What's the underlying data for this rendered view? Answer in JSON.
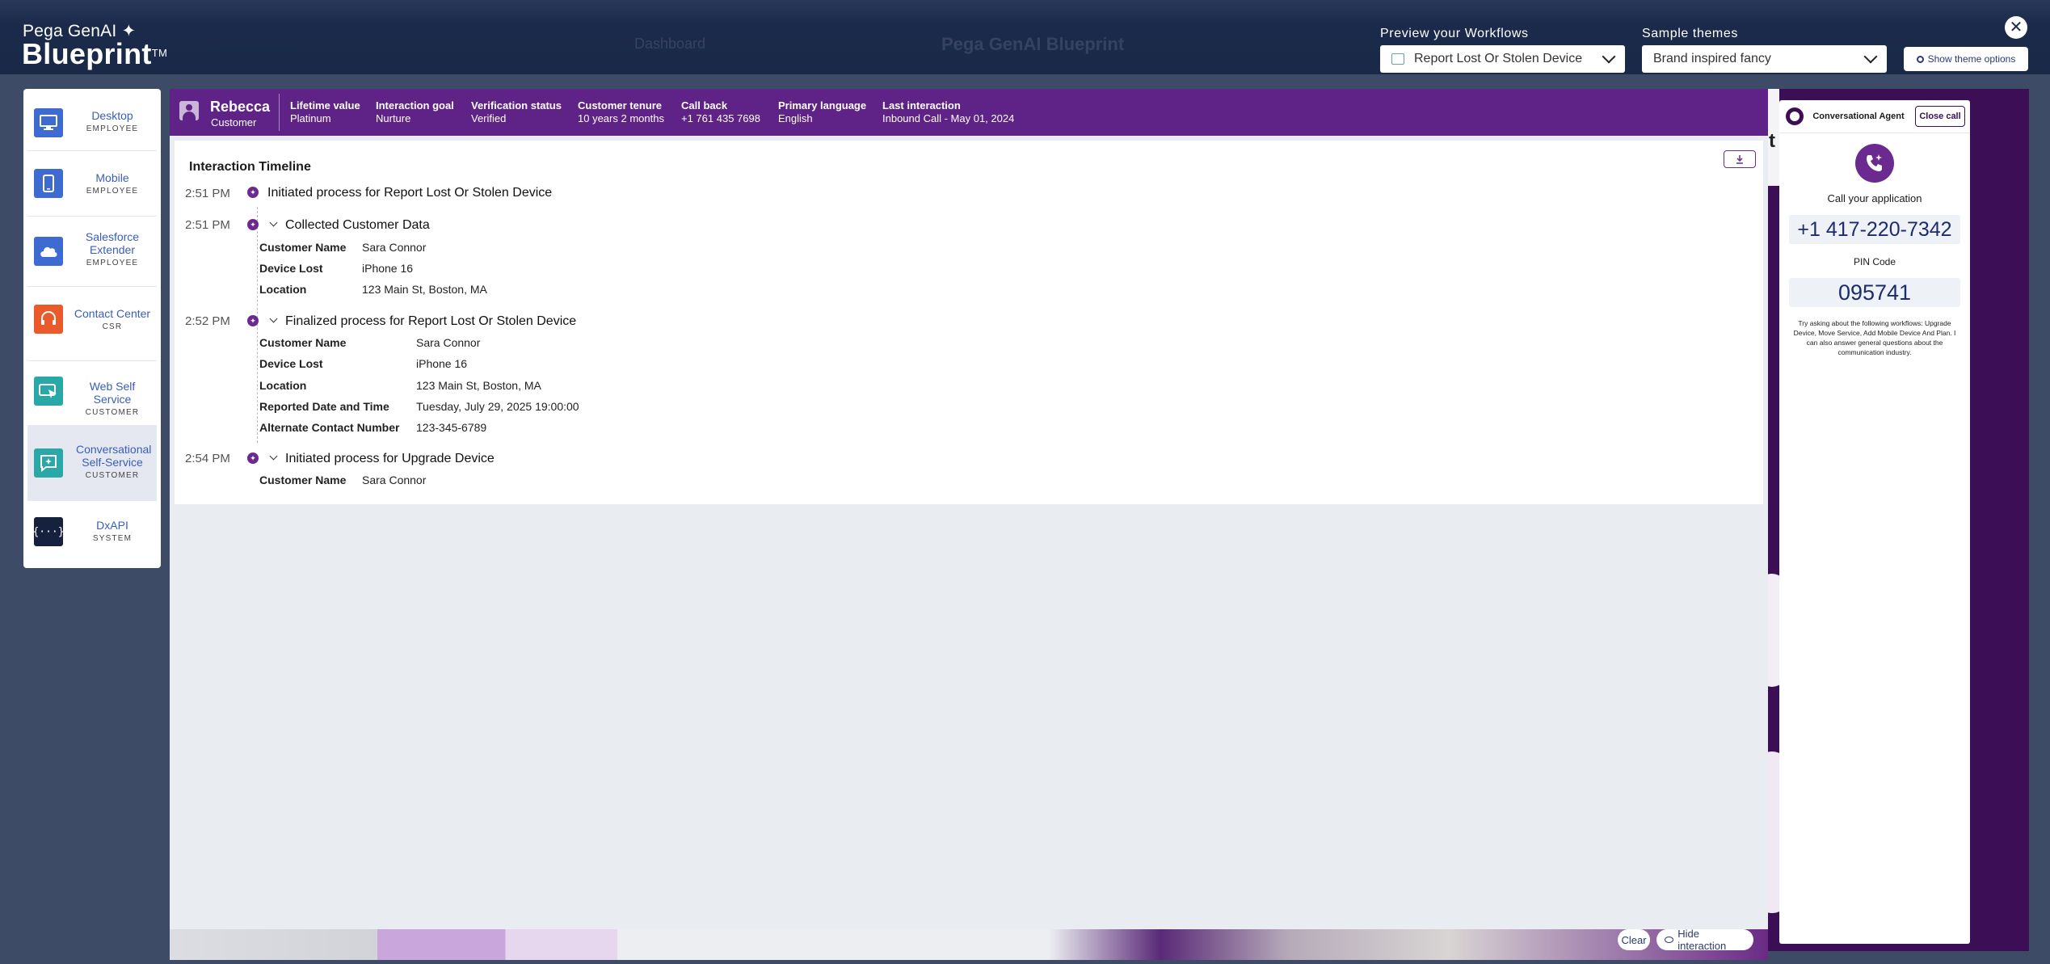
{
  "header": {
    "brand_line1": "Pega GenAI",
    "brand_spark": "✦",
    "brand_line2": "Blueprint",
    "brand_tm": "TM",
    "preview_label": "Preview your Workflows",
    "preview_value": "Report Lost Or Stolen Device",
    "themes_label": "Sample themes",
    "themes_value": "Brand inspired fancy",
    "theme_options_label": "Show theme options",
    "close_symbol": "✕",
    "ghost_dashboard": "Dashboard",
    "ghost_title": "Pega GenAI Blueprint"
  },
  "nav": {
    "items": [
      {
        "title": "Desktop",
        "sub": "EMPLOYEE",
        "icon": "desktop-icon",
        "color": "#3d6bd1"
      },
      {
        "title": "Mobile",
        "sub": "EMPLOYEE",
        "icon": "mobile-icon",
        "color": "#3d6bd1"
      },
      {
        "title": "Salesforce Extender",
        "sub": "EMPLOYEE",
        "icon": "cloud-icon",
        "color": "#3d6bd1"
      },
      {
        "title": "Contact Center",
        "sub": "CSR",
        "icon": "headset-icon",
        "color": "#ea5a2b"
      },
      {
        "title": "Web Self Service",
        "sub": "CUSTOMER",
        "icon": "web-pointer-icon",
        "color": "#2aa7a7"
      },
      {
        "title": "Conversational Self-Service",
        "sub": "CUSTOMER",
        "icon": "chat-spark-icon",
        "color": "#2aa7a7"
      },
      {
        "title": "DxAPI",
        "sub": "SYSTEM",
        "icon": "code-braces-icon",
        "color": "#16213d"
      }
    ]
  },
  "customer": {
    "name": "Rebecca",
    "role": "Customer",
    "fields": [
      {
        "label": "Lifetime value",
        "value": "Platinum"
      },
      {
        "label": "Interaction goal",
        "value": "Nurture"
      },
      {
        "label": "Verification status",
        "value": "Verified"
      },
      {
        "label": "Customer tenure",
        "value": "10 years 2 months"
      },
      {
        "label": "Call back",
        "value": "+1 761 435 7698"
      },
      {
        "label": "Primary language",
        "value": "English"
      },
      {
        "label": "Last interaction",
        "value": "Inbound Call - May 01, 2024"
      }
    ]
  },
  "timeline": {
    "title": "Interaction Timeline",
    "events": [
      {
        "time": "2:51 PM",
        "title": "Initiated process for Report Lost Or Stolen Device",
        "details": []
      },
      {
        "time": "2:51 PM",
        "title": "Collected Customer Data",
        "details": [
          {
            "k": "Customer Name",
            "v": "Sara Connor"
          },
          {
            "k": "Device Lost",
            "v": "iPhone 16"
          },
          {
            "k": "Location",
            "v": "123 Main St, Boston, MA"
          }
        ]
      },
      {
        "time": "2:52 PM",
        "title": "Finalized process for Report Lost Or Stolen Device",
        "details": [
          {
            "k": "Customer Name",
            "v": "Sara Connor"
          },
          {
            "k": "Device Lost",
            "v": "iPhone 16"
          },
          {
            "k": "Location",
            "v": "123 Main St, Boston, MA"
          },
          {
            "k": "Reported Date and Time",
            "v": "Tuesday, July 29, 2025 19:00:00"
          },
          {
            "k": "Alternate Contact Number",
            "v": "123-345-6789"
          }
        ]
      },
      {
        "time": "2:54 PM",
        "title": "Initiated process for Upgrade Device",
        "details": [
          {
            "k": "Customer Name",
            "v": "Sara Connor"
          }
        ]
      }
    ]
  },
  "footer": {
    "clear_label": "Clear",
    "hide_label": "Hide interaction"
  },
  "agent": {
    "title": "Conversational Agent",
    "close_call": "Close call",
    "call_label": "Call your application",
    "phone": "+1 417-220-7342",
    "pin_label": "PIN Code",
    "pin": "095741",
    "hint": "Try asking about the following workflows: Upgrade Device, Move Service, Add Mobile Device And Plan. I can also answer general questions about the communication industry.",
    "bg_letter": "t"
  },
  "colors": {
    "header_bg": "#1a2948",
    "customer_bar": "#5f2387",
    "timeline_dot": "#6a2a90",
    "nav_link": "#3a5db8"
  }
}
